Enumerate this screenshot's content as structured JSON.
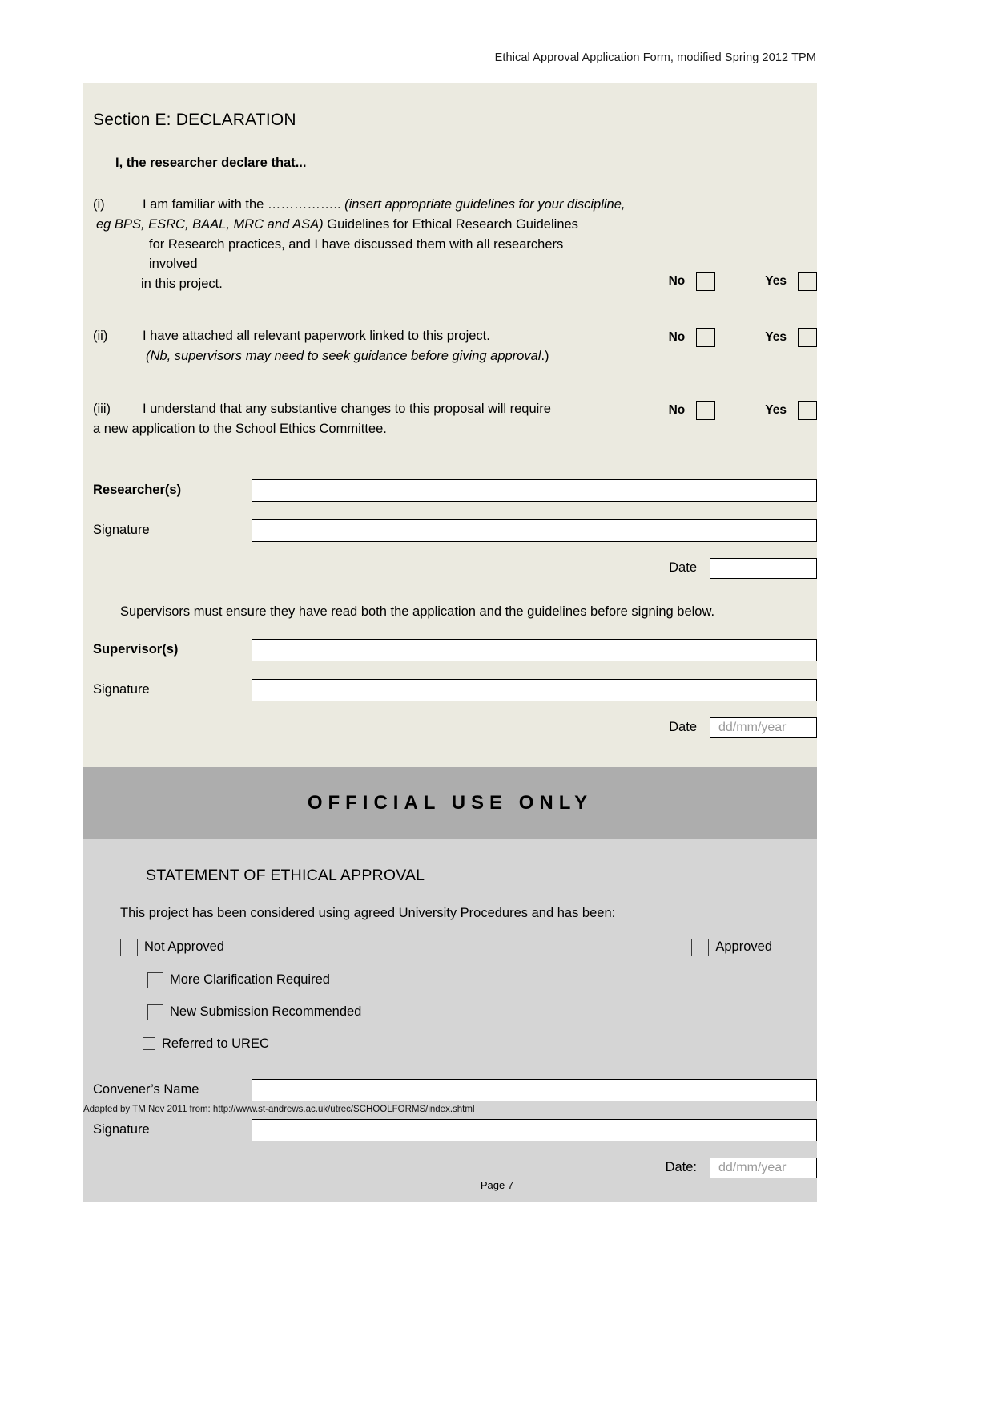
{
  "header": {
    "running_head": "Ethical Approval Application Form, modified Spring 2012  TPM"
  },
  "declaration": {
    "section_title": "Section E: DECLARATION",
    "lead_in": "I, the researcher declare that...",
    "items": [
      {
        "roman": "(i)",
        "line1_a": "I am familiar with the ……………..",
        "line1_b": " (insert appropriate guidelines for your discipline,",
        "line2_a": "eg BPS, ESRC, BAAL, MRC and ASA)",
        "line2_b": " Guidelines for Ethical Research Guidelines",
        "line3": "for Research practices, and I have discussed them with all researchers",
        "line4": "involved",
        "line5": "in this project.",
        "no_label": "No",
        "yes_label": "Yes"
      },
      {
        "roman": "(ii)",
        "line1": "I have attached all relevant paperwork linked to this project.",
        "line2_a": "(Nb, supervisors may need to seek guidance before giving approval",
        "line2_b": ".)",
        "no_label": "No",
        "yes_label": "Yes"
      },
      {
        "roman": "(iii)",
        "line1": "I understand that any substantive changes to this proposal will require",
        "line2": "a new application to the School Ethics Committee.",
        "no_label": "No",
        "yes_label": "Yes"
      }
    ],
    "researcher_label": "Researcher(s)",
    "researcher_value": "",
    "researcher_signature_label": "Signature",
    "researcher_signature_value": "",
    "researcher_date_label": "Date",
    "researcher_date_value": "",
    "researcher_date_placeholder": "",
    "supervisor_note": "Supervisors must ensure they have read both the application and the guidelines before signing below.",
    "supervisor_label": "Supervisor(s)",
    "supervisor_value": "",
    "supervisor_signature_label": "Signature",
    "supervisor_signature_value": "",
    "supervisor_date_label": "Date",
    "supervisor_date_placeholder": "dd/mm/year"
  },
  "official": {
    "banner": "OFFICIAL USE ONLY",
    "statement_title": "STATEMENT OF ETHICAL APPROVAL",
    "statement_sub": "This project has been considered using agreed University Procedures and has been:",
    "not_approved_label": "Not Approved",
    "approved_label": "Approved",
    "options": [
      "More Clarification Required",
      "New Submission Recommended",
      "Referred to UREC"
    ],
    "convener_label": "Convener’s Name",
    "convener_value": "",
    "signature_label": "Signature",
    "signature_value": "",
    "date_label": "Date:",
    "date_placeholder": "dd/mm/year"
  },
  "footer": {
    "adapted_note": "Adapted by TM Nov 2011 from: http://www.st-andrews.ac.uk/utrec/SCHOOLFORMS/index.shtml",
    "page_number": "Page 7"
  },
  "colors": {
    "declaration_panel": "#ebeae0",
    "official_banner": "#adadad",
    "official_panel": "#d5d5d5",
    "placeholder_text": "#9a9a9a"
  }
}
